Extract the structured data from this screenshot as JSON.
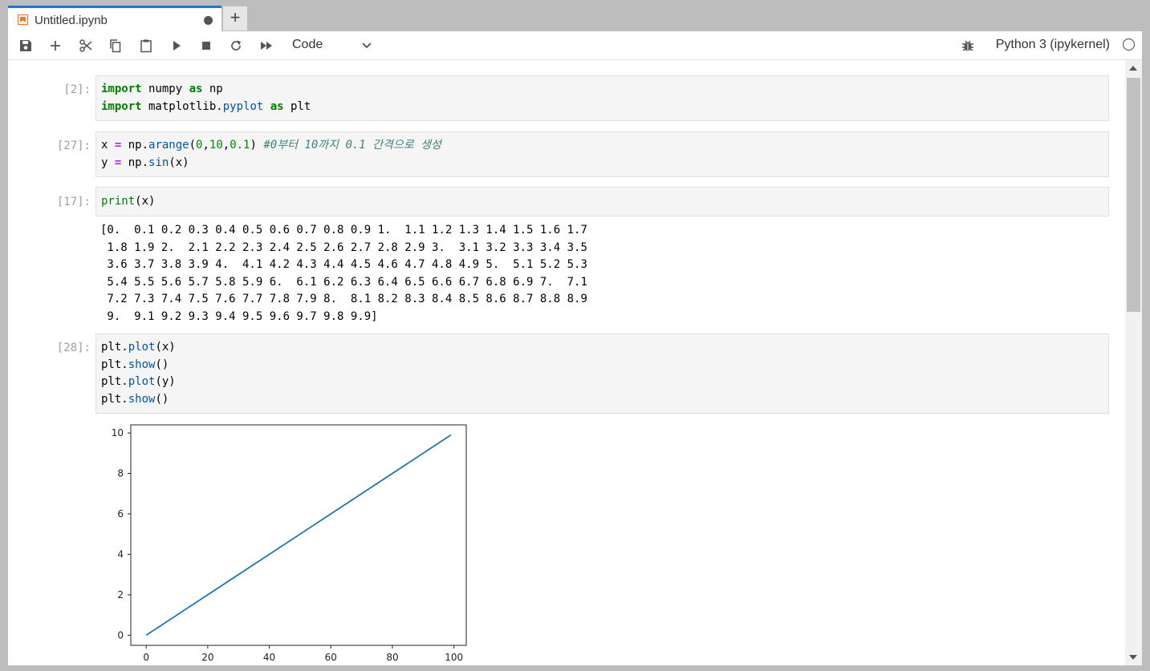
{
  "tab": {
    "title": "Untitled.ipynb",
    "new_tab": "+"
  },
  "toolbar": {
    "buttons": [
      "save-icon",
      "add-cell-icon",
      "cut-icon",
      "copy-icon",
      "paste-icon",
      "run-icon",
      "stop-icon",
      "restart-icon",
      "fast-forward-icon"
    ],
    "cell_type": "Code",
    "kernel_name": "Python 3 (ipykernel)"
  },
  "cells": [
    {
      "prompt": "[2]:",
      "lines": [
        [
          [
            "kw",
            "import"
          ],
          [
            "t",
            " numpy "
          ],
          [
            "kw",
            "as"
          ],
          [
            "t",
            " np"
          ]
        ],
        [
          [
            "kw",
            "import"
          ],
          [
            "t",
            " matplotlib"
          ],
          [
            "t",
            "."
          ],
          [
            "fn",
            "pyplot"
          ],
          [
            "t",
            " "
          ],
          [
            "kw",
            "as"
          ],
          [
            "t",
            " plt"
          ]
        ]
      ]
    },
    {
      "prompt": "[27]:",
      "lines": [
        [
          [
            "t",
            "x "
          ],
          [
            "op",
            "="
          ],
          [
            "t",
            " np."
          ],
          [
            "fn",
            "arange"
          ],
          [
            "t",
            "("
          ],
          [
            "num",
            "0"
          ],
          [
            "t",
            ","
          ],
          [
            "num",
            "10"
          ],
          [
            "t",
            ","
          ],
          [
            "num",
            "0.1"
          ],
          [
            "t",
            ") "
          ],
          [
            "cm",
            "#0부터 10까지 0.1 간격으로 생성"
          ]
        ],
        [
          [
            "t",
            "y "
          ],
          [
            "op",
            "="
          ],
          [
            "t",
            " np."
          ],
          [
            "fn",
            "sin"
          ],
          [
            "t",
            "(x)"
          ]
        ]
      ]
    },
    {
      "prompt": "[17]:",
      "lines": [
        [
          [
            "bi",
            "print"
          ],
          [
            "t",
            "(x)"
          ]
        ]
      ]
    },
    {
      "prompt": "[28]:",
      "lines": [
        [
          [
            "t",
            "plt."
          ],
          [
            "fn",
            "plot"
          ],
          [
            "t",
            "(x)"
          ]
        ],
        [
          [
            "t",
            "plt."
          ],
          [
            "fn",
            "show"
          ],
          [
            "t",
            "()"
          ]
        ],
        [
          [
            "t",
            "plt."
          ],
          [
            "fn",
            "plot"
          ],
          [
            "t",
            "(y)"
          ]
        ],
        [
          [
            "t",
            "plt."
          ],
          [
            "fn",
            "show"
          ],
          [
            "t",
            "()"
          ]
        ]
      ]
    }
  ],
  "output_17": "[0.  0.1 0.2 0.3 0.4 0.5 0.6 0.7 0.8 0.9 1.  1.1 1.2 1.3 1.4 1.5 1.6 1.7\n 1.8 1.9 2.  2.1 2.2 2.3 2.4 2.5 2.6 2.7 2.8 2.9 3.  3.1 3.2 3.3 3.4 3.5\n 3.6 3.7 3.8 3.9 4.  4.1 4.2 4.3 4.4 4.5 4.6 4.7 4.8 4.9 5.  5.1 5.2 5.3\n 5.4 5.5 5.6 5.7 5.8 5.9 6.  6.1 6.2 6.3 6.4 6.5 6.6 6.7 6.8 6.9 7.  7.1\n 7.2 7.3 7.4 7.5 7.6 7.7 7.8 7.9 8.  8.1 8.2 8.3 8.4 8.5 8.6 8.7 8.8 8.9\n 9.  9.1 9.2 9.3 9.4 9.5 9.6 9.7 9.8 9.9]",
  "chart_data": {
    "type": "line",
    "x": [
      0,
      99
    ],
    "series": [
      {
        "values": [
          0,
          9.9
        ],
        "color": "#1f77b4"
      }
    ],
    "xticks": [
      "0",
      "20",
      "40",
      "60",
      "80",
      "100"
    ],
    "yticks": [
      "0",
      "2",
      "4",
      "6",
      "8",
      "10"
    ],
    "xlim": [
      -5,
      104
    ],
    "ylim": [
      -0.5,
      10.4
    ],
    "xlabel": "",
    "ylabel": "",
    "title": ""
  }
}
